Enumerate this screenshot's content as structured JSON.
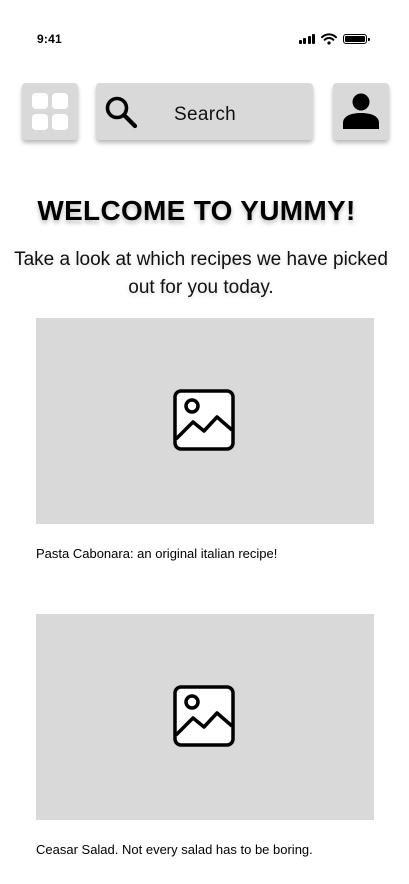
{
  "status_bar": {
    "time": "9:41",
    "icons": [
      "signal-icon",
      "wifi-icon",
      "battery-icon"
    ]
  },
  "header": {
    "menu_icon": "grid-icon",
    "search": {
      "icon": "search-icon",
      "label": "Search"
    },
    "profile_icon": "user-icon"
  },
  "welcome": {
    "title": "WELCOME TO YUMMY!",
    "subtitle": "Take a look at which recipes we have picked out for you today."
  },
  "recipes": [
    {
      "image_icon": "image-placeholder-icon",
      "caption": "Pasta Cabonara: an original italian recipe!"
    },
    {
      "image_icon": "image-placeholder-icon",
      "caption": "Ceasar Salad. Not every salad has to be boring."
    }
  ],
  "colors": {
    "placeholder": "#d9d9d9",
    "text": "#000000",
    "background": "#ffffff"
  }
}
